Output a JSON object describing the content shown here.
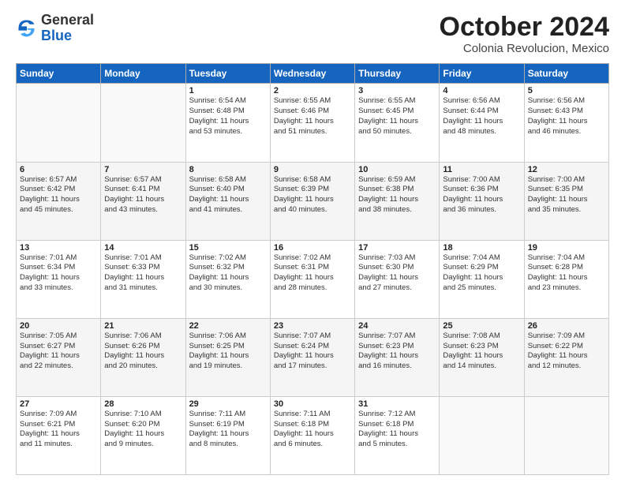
{
  "header": {
    "logo_general": "General",
    "logo_blue": "Blue",
    "month_title": "October 2024",
    "subtitle": "Colonia Revolucion, Mexico"
  },
  "days_of_week": [
    "Sunday",
    "Monday",
    "Tuesday",
    "Wednesday",
    "Thursday",
    "Friday",
    "Saturday"
  ],
  "weeks": [
    [
      {
        "day": "",
        "info": ""
      },
      {
        "day": "",
        "info": ""
      },
      {
        "day": "1",
        "info": "Sunrise: 6:54 AM\nSunset: 6:48 PM\nDaylight: 11 hours\nand 53 minutes."
      },
      {
        "day": "2",
        "info": "Sunrise: 6:55 AM\nSunset: 6:46 PM\nDaylight: 11 hours\nand 51 minutes."
      },
      {
        "day": "3",
        "info": "Sunrise: 6:55 AM\nSunset: 6:45 PM\nDaylight: 11 hours\nand 50 minutes."
      },
      {
        "day": "4",
        "info": "Sunrise: 6:56 AM\nSunset: 6:44 PM\nDaylight: 11 hours\nand 48 minutes."
      },
      {
        "day": "5",
        "info": "Sunrise: 6:56 AM\nSunset: 6:43 PM\nDaylight: 11 hours\nand 46 minutes."
      }
    ],
    [
      {
        "day": "6",
        "info": "Sunrise: 6:57 AM\nSunset: 6:42 PM\nDaylight: 11 hours\nand 45 minutes."
      },
      {
        "day": "7",
        "info": "Sunrise: 6:57 AM\nSunset: 6:41 PM\nDaylight: 11 hours\nand 43 minutes."
      },
      {
        "day": "8",
        "info": "Sunrise: 6:58 AM\nSunset: 6:40 PM\nDaylight: 11 hours\nand 41 minutes."
      },
      {
        "day": "9",
        "info": "Sunrise: 6:58 AM\nSunset: 6:39 PM\nDaylight: 11 hours\nand 40 minutes."
      },
      {
        "day": "10",
        "info": "Sunrise: 6:59 AM\nSunset: 6:38 PM\nDaylight: 11 hours\nand 38 minutes."
      },
      {
        "day": "11",
        "info": "Sunrise: 7:00 AM\nSunset: 6:36 PM\nDaylight: 11 hours\nand 36 minutes."
      },
      {
        "day": "12",
        "info": "Sunrise: 7:00 AM\nSunset: 6:35 PM\nDaylight: 11 hours\nand 35 minutes."
      }
    ],
    [
      {
        "day": "13",
        "info": "Sunrise: 7:01 AM\nSunset: 6:34 PM\nDaylight: 11 hours\nand 33 minutes."
      },
      {
        "day": "14",
        "info": "Sunrise: 7:01 AM\nSunset: 6:33 PM\nDaylight: 11 hours\nand 31 minutes."
      },
      {
        "day": "15",
        "info": "Sunrise: 7:02 AM\nSunset: 6:32 PM\nDaylight: 11 hours\nand 30 minutes."
      },
      {
        "day": "16",
        "info": "Sunrise: 7:02 AM\nSunset: 6:31 PM\nDaylight: 11 hours\nand 28 minutes."
      },
      {
        "day": "17",
        "info": "Sunrise: 7:03 AM\nSunset: 6:30 PM\nDaylight: 11 hours\nand 27 minutes."
      },
      {
        "day": "18",
        "info": "Sunrise: 7:04 AM\nSunset: 6:29 PM\nDaylight: 11 hours\nand 25 minutes."
      },
      {
        "day": "19",
        "info": "Sunrise: 7:04 AM\nSunset: 6:28 PM\nDaylight: 11 hours\nand 23 minutes."
      }
    ],
    [
      {
        "day": "20",
        "info": "Sunrise: 7:05 AM\nSunset: 6:27 PM\nDaylight: 11 hours\nand 22 minutes."
      },
      {
        "day": "21",
        "info": "Sunrise: 7:06 AM\nSunset: 6:26 PM\nDaylight: 11 hours\nand 20 minutes."
      },
      {
        "day": "22",
        "info": "Sunrise: 7:06 AM\nSunset: 6:25 PM\nDaylight: 11 hours\nand 19 minutes."
      },
      {
        "day": "23",
        "info": "Sunrise: 7:07 AM\nSunset: 6:24 PM\nDaylight: 11 hours\nand 17 minutes."
      },
      {
        "day": "24",
        "info": "Sunrise: 7:07 AM\nSunset: 6:23 PM\nDaylight: 11 hours\nand 16 minutes."
      },
      {
        "day": "25",
        "info": "Sunrise: 7:08 AM\nSunset: 6:23 PM\nDaylight: 11 hours\nand 14 minutes."
      },
      {
        "day": "26",
        "info": "Sunrise: 7:09 AM\nSunset: 6:22 PM\nDaylight: 11 hours\nand 12 minutes."
      }
    ],
    [
      {
        "day": "27",
        "info": "Sunrise: 7:09 AM\nSunset: 6:21 PM\nDaylight: 11 hours\nand 11 minutes."
      },
      {
        "day": "28",
        "info": "Sunrise: 7:10 AM\nSunset: 6:20 PM\nDaylight: 11 hours\nand 9 minutes."
      },
      {
        "day": "29",
        "info": "Sunrise: 7:11 AM\nSunset: 6:19 PM\nDaylight: 11 hours\nand 8 minutes."
      },
      {
        "day": "30",
        "info": "Sunrise: 7:11 AM\nSunset: 6:18 PM\nDaylight: 11 hours\nand 6 minutes."
      },
      {
        "day": "31",
        "info": "Sunrise: 7:12 AM\nSunset: 6:18 PM\nDaylight: 11 hours\nand 5 minutes."
      },
      {
        "day": "",
        "info": ""
      },
      {
        "day": "",
        "info": ""
      }
    ]
  ]
}
